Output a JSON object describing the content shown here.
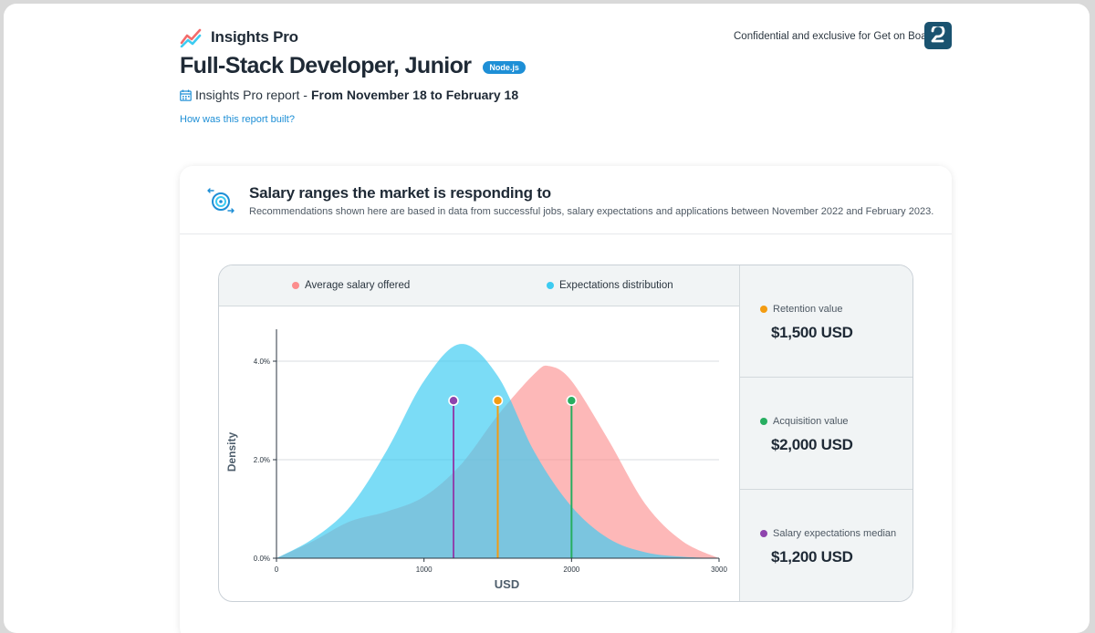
{
  "header": {
    "brand": "Insights Pro",
    "confidential": "Confidential and exclusive for Get on Board",
    "job_title": "Full-Stack Developer, Junior",
    "tag": "Node.js",
    "report_label": "Insights Pro report -",
    "report_range": "From November 18 to February 18",
    "how_link": "How was this report built?"
  },
  "card": {
    "title": "Salary ranges the market is responding to",
    "subtitle": "Recommendations shown here are based in data from successful jobs, salary expectations and applications between November 2022 and February 2023."
  },
  "legend": {
    "offered": "Average salary offered",
    "expectations": "Expectations distribution"
  },
  "stats": [
    {
      "label": "Retention value",
      "value": "$1,500 USD",
      "color": "#f39c12"
    },
    {
      "label": "Acquisition value",
      "value": "$2,000 USD",
      "color": "#27ae60"
    },
    {
      "label": "Salary expectations median",
      "value": "$1,200 USD",
      "color": "#8e44ad"
    }
  ],
  "colors": {
    "offered": "#fc8d8d",
    "expectations": "#3dcbf1",
    "accent": "#1e8fd6"
  },
  "chart_data": {
    "type": "area",
    "xlabel": "USD",
    "ylabel": "Density",
    "xlim": [
      0,
      3000
    ],
    "ylim": [
      0,
      0.045
    ],
    "x_ticks": [
      "0",
      "1000",
      "2000",
      "3000"
    ],
    "y_ticks": [
      "0.0%",
      "2.0%",
      "4.0%"
    ],
    "y_tick_values": [
      0,
      0.02,
      0.04
    ],
    "x_tick_values": [
      0,
      1000,
      2000,
      3000
    ],
    "series": [
      {
        "name": "Average salary offered",
        "points": [
          [
            0,
            0
          ],
          [
            250,
            0.0035
          ],
          [
            500,
            0.0075
          ],
          [
            750,
            0.0095
          ],
          [
            1000,
            0.0125
          ],
          [
            1250,
            0.019
          ],
          [
            1500,
            0.029
          ],
          [
            1750,
            0.0375
          ],
          [
            1850,
            0.039
          ],
          [
            2000,
            0.036
          ],
          [
            2250,
            0.024
          ],
          [
            2500,
            0.011
          ],
          [
            2750,
            0.0035
          ],
          [
            3000,
            0
          ]
        ]
      },
      {
        "name": "Expectations distribution",
        "points": [
          [
            0,
            0
          ],
          [
            250,
            0.004
          ],
          [
            500,
            0.0105
          ],
          [
            750,
            0.022
          ],
          [
            1000,
            0.036
          ],
          [
            1250,
            0.0435
          ],
          [
            1500,
            0.037
          ],
          [
            1750,
            0.0215
          ],
          [
            2000,
            0.0105
          ],
          [
            2250,
            0.004
          ],
          [
            2500,
            0.0012
          ],
          [
            2750,
            0.0003
          ],
          [
            3000,
            0
          ]
        ]
      }
    ],
    "markers": [
      {
        "label": "Salary expectations median",
        "x": 1200,
        "y": 0.032,
        "color": "#8e44ad"
      },
      {
        "label": "Retention value",
        "x": 1500,
        "y": 0.032,
        "color": "#f39c12"
      },
      {
        "label": "Acquisition value",
        "x": 2000,
        "y": 0.032,
        "color": "#27ae60"
      }
    ]
  }
}
